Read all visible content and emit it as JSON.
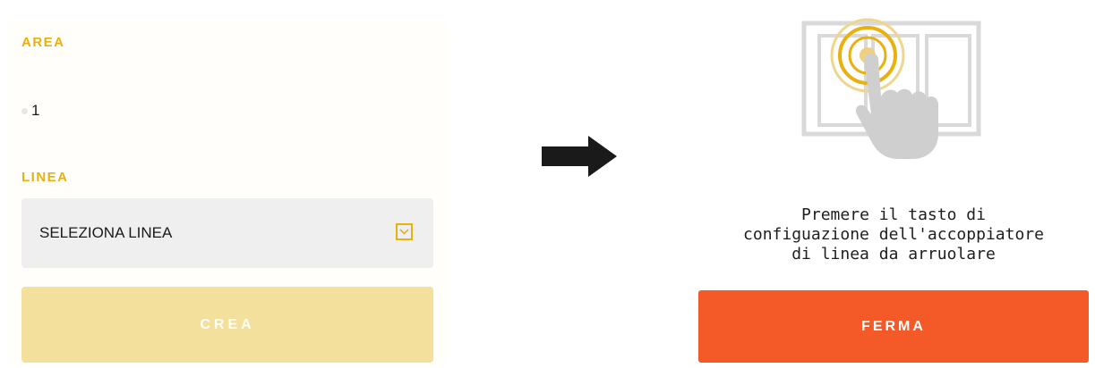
{
  "left_panel": {
    "area_label": "AREA",
    "area_value": "1",
    "linea_label": "LINEA",
    "linea_select": {
      "selected": "SELEZIONA LINEA",
      "icon": "chevron-down-icon"
    },
    "crea_button": "CREA"
  },
  "arrow": {
    "icon": "arrow-right-icon"
  },
  "right_panel": {
    "illustration_icon": "hand-pressing-button-icon",
    "instruction_lines": [
      "Premere il tasto di",
      "configuazione dell'accoppiatore",
      "di linea da arruolare"
    ],
    "ferma_button": "FERMA"
  },
  "colors": {
    "accent_yellow": "#e8b10f",
    "disabled_button": "#f4e09d",
    "stop_button": "#f35a27",
    "select_background": "#efefef"
  }
}
